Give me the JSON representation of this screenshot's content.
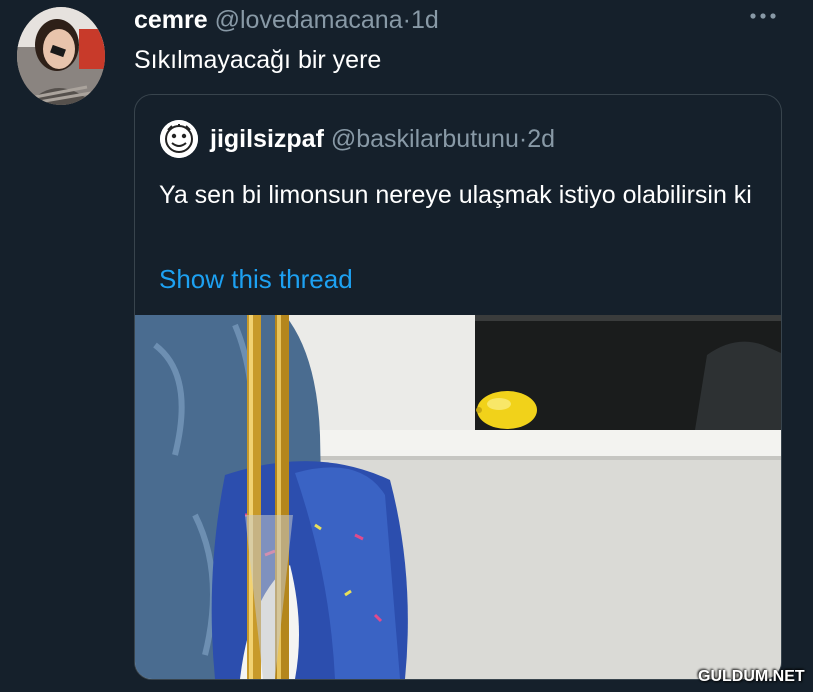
{
  "tweet": {
    "display_name": "cemre",
    "handle": "@lovedamacana",
    "separator": "·",
    "time": "1d",
    "text": "Sıkılmayacağı bir yere",
    "more_icon": "more-horizontal-icon"
  },
  "quoted_tweet": {
    "display_name": "jigilsizpaf",
    "handle": "@baskilarbutunu",
    "separator": "·",
    "time": "2d",
    "text": "Ya sen bi limonsun nereye ulaşmak istiyo olabilirsin ki",
    "show_thread": "Show this thread"
  },
  "watermark": "GULDUM.NET",
  "colors": {
    "background": "#15202b",
    "secondary_text": "#8899a6",
    "link": "#1da1f2",
    "border": "#38444d"
  }
}
